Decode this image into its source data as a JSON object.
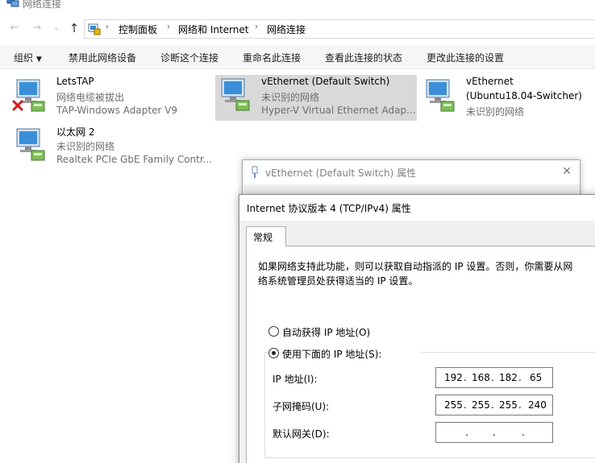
{
  "window": {
    "title": "网络连接"
  },
  "nav": {
    "back": "←",
    "forward": "→",
    "dropdown": "⌄",
    "up": "↑",
    "breadcrumbs": [
      "控制面板",
      "网络和 Internet",
      "网络连接"
    ],
    "separator": "›"
  },
  "toolbar": {
    "organize": "组织",
    "caret": "▼",
    "disable": "禁用此网络设备",
    "diagnose": "诊断这个连接",
    "rename": "重命名此连接",
    "status": "查看此连接的状态",
    "settings": "更改此连接的设置"
  },
  "adapters": [
    {
      "name": "LetsTAP",
      "status": "网络电缆被拔出",
      "device": "TAP-Windows Adapter V9",
      "icon": "network-adapter-disconnected-icon"
    },
    {
      "name": "vEthernet (Default Switch)",
      "status": "未识别的网络",
      "device": "Hyper-V Virtual Ethernet Adap...",
      "icon": "network-adapter-icon",
      "selected": true
    },
    {
      "name": "vEthernet",
      "name2": "(Ubuntu18.04-Switcher)",
      "status": "未识别的网络",
      "icon": "network-adapter-icon"
    },
    {
      "name": "以太网 2",
      "status": "未识别的网络",
      "device": "Realtek PCIe GbE Family Contr...",
      "icon": "network-adapter-icon"
    }
  ],
  "dialog_adapter": {
    "title": "vEthernet (Default Switch) 属性",
    "close": "✕"
  },
  "dialog_ipv4": {
    "title": "Internet 协议版本 4 (TCP/IPv4) 属性",
    "tab": "常规",
    "description_line1": "如果网络支持此功能，则可以获取自动指派的 IP 设置。否则，你需要从网",
    "description_line2": "络系统管理员处获得适当的 IP 设置。",
    "radio_auto": "自动获得 IP 地址(O)",
    "radio_manual": "使用下面的 IP 地址(S):",
    "ip_label": "IP 地址(I):",
    "ip": [
      "192",
      "168",
      "182",
      "65"
    ],
    "mask_label": "子网掩码(U):",
    "mask": [
      "255",
      "255",
      "255",
      "240"
    ],
    "gateway_label": "默认网关(D):",
    "gateway": [
      "",
      "",
      "",
      ""
    ],
    "dot": "."
  },
  "colors": {
    "selected_bg": "#d9d9d9",
    "muted_text": "#6d6d6d",
    "toolbar_bg": "#f5f6f7"
  }
}
